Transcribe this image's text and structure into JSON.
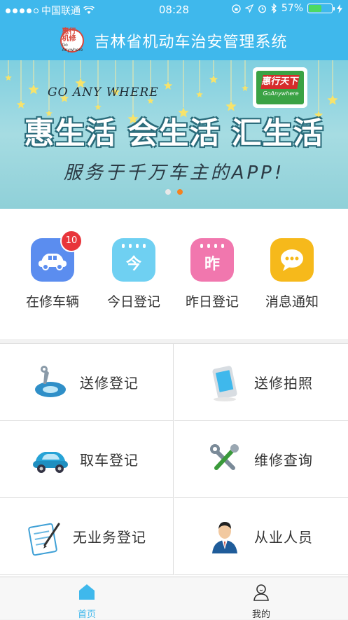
{
  "status_bar": {
    "carrier": "中国联通",
    "time": "08:28",
    "battery": "57%",
    "battery_level": 0.57
  },
  "nav": {
    "title": "吉林省机动车治安管理系统",
    "logo_text": "惠行·机修",
    "logo_sub": "Go Anywhere"
  },
  "banner": {
    "go_any_where": "GO ANY WHERE",
    "slogan": "惠生活 会生活 汇生活",
    "tagline": "服务于千万车主的APP!",
    "brand_name": "惠行天下",
    "brand_sub": "GoAnywhere",
    "active_slide": 2,
    "slide_count": 2
  },
  "quick_actions": [
    {
      "label": "在修车辆",
      "icon": "car-icon",
      "color": "#5b8def",
      "badge": "10"
    },
    {
      "label": "今日登记",
      "icon": "calendar-today-icon",
      "color": "#6fd0f2",
      "glyph": "今"
    },
    {
      "label": "昨日登记",
      "icon": "calendar-yesterday-icon",
      "color": "#f177ae",
      "glyph": "昨"
    },
    {
      "label": "消息通知",
      "icon": "message-icon",
      "color": "#f6b91b"
    }
  ],
  "grid": [
    {
      "label": "送修登记",
      "icon": "wrench-tire-icon"
    },
    {
      "label": "送修拍照",
      "icon": "phone-camera-icon"
    },
    {
      "label": "取车登记",
      "icon": "car-pickup-icon"
    },
    {
      "label": "维修查询",
      "icon": "tools-search-icon"
    },
    {
      "label": "无业务登记",
      "icon": "clipboard-icon"
    },
    {
      "label": "从业人员",
      "icon": "staff-icon"
    }
  ],
  "tabbar": [
    {
      "label": "首页",
      "icon": "home-icon",
      "active": true
    },
    {
      "label": "我的",
      "icon": "profile-icon",
      "active": false
    }
  ],
  "colors": {
    "header": "#3fb8ec",
    "tab_active": "#3fb8ec",
    "tab_inactive": "#333333",
    "badge": "#e8353b",
    "carousel_active": "#f5821f"
  }
}
